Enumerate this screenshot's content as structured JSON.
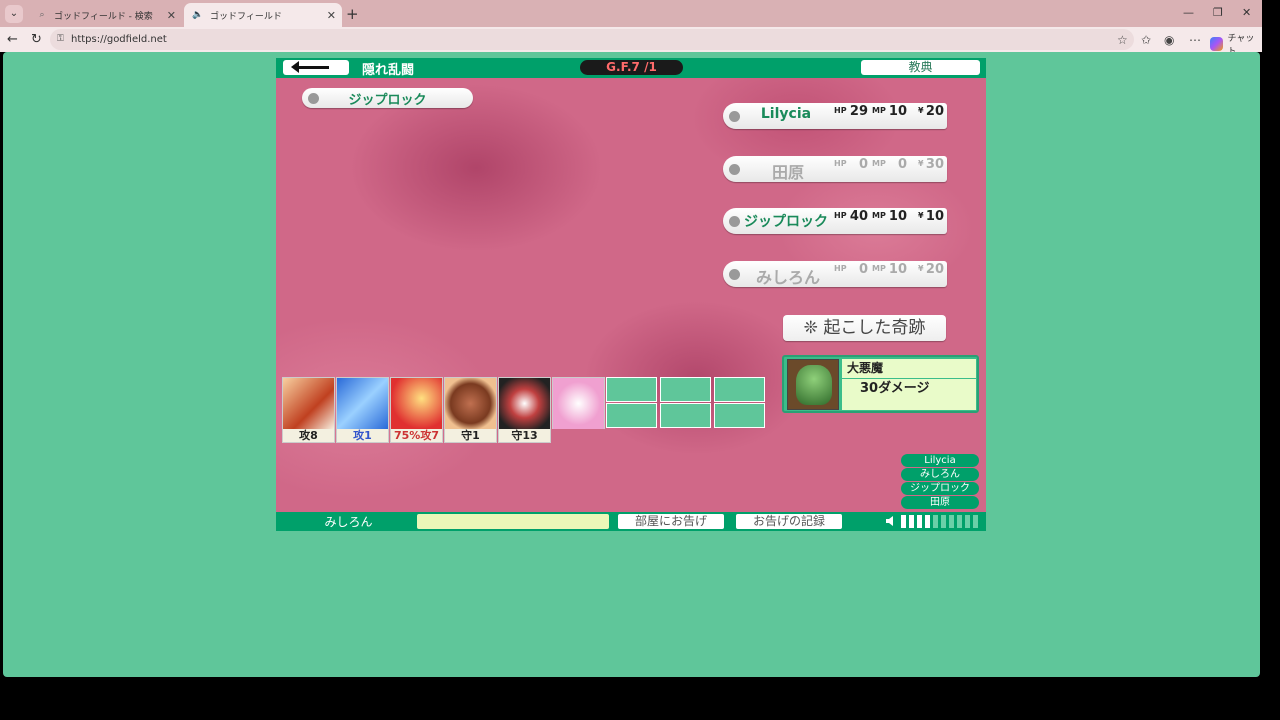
{
  "browser": {
    "tabs": [
      {
        "title": "ゴッドフィールド - 検索",
        "icon": "search-icon"
      },
      {
        "title": "ゴッドフィールド",
        "icon": "speaker-icon"
      }
    ],
    "url": "https://godfield.net",
    "chat_label": "チャット"
  },
  "game": {
    "room_title": "隠れ乱闘",
    "gf_badge": "G.F.7 /1",
    "kyoten_label": "教典",
    "self_name": "ジップロック",
    "players": [
      {
        "name": "Lilycia",
        "hp": "29",
        "mp": "10",
        "money": "20",
        "alive": true
      },
      {
        "name": "田原",
        "hp": "0",
        "mp": "0",
        "money": "30",
        "alive": false
      },
      {
        "name": "ジップロック",
        "hp": "40",
        "mp": "10",
        "money": "10",
        "alive": true
      },
      {
        "name": "みしろん",
        "hp": "0",
        "mp": "10",
        "money": "20",
        "alive": false
      }
    ],
    "stat_labels": {
      "hp": "HP",
      "mp": "MP",
      "money": "¥"
    },
    "miracle_label": "❊ 起こした奇跡",
    "event": {
      "name": "大悪魔",
      "effect": "30ダメージ"
    },
    "cards": [
      {
        "label": "攻8",
        "color": "#222"
      },
      {
        "label": "攻1",
        "color": "#3355cc"
      },
      {
        "label": "75%攻7",
        "color": "#cc3333"
      },
      {
        "label": "守1",
        "color": "#222"
      },
      {
        "label": "守13",
        "color": "#222"
      },
      {
        "label": "",
        "color": "#222"
      }
    ],
    "name_list": [
      "Lilycia",
      "みしろん",
      "ジップロック",
      "田原"
    ],
    "bottom": {
      "my_name": "みしろん",
      "announce_room": "部屋にお告げ",
      "announce_log": "お告げの記録"
    },
    "volume_level": 0.4
  }
}
